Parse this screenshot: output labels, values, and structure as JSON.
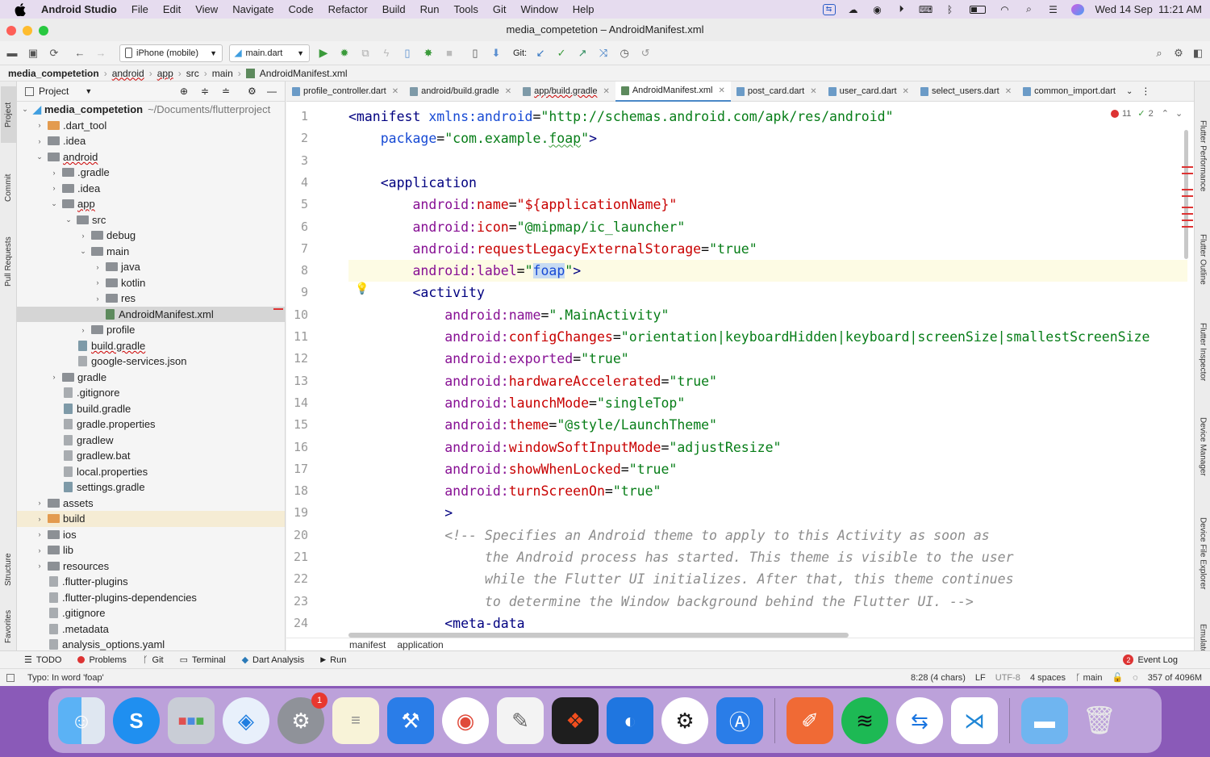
{
  "menubar": {
    "app": "Android Studio",
    "items": [
      "File",
      "Edit",
      "View",
      "Navigate",
      "Code",
      "Refactor",
      "Build",
      "Run",
      "Tools",
      "Git",
      "Window",
      "Help"
    ],
    "clock": "Wed 14 Sep  11:21 AM"
  },
  "window": {
    "title": "media_competetion – AndroidManifest.xml"
  },
  "toolbar": {
    "device": "iPhone (mobile)",
    "run_config": "main.dart",
    "git_label": "Git:"
  },
  "breadcrumb": [
    "media_competetion",
    "android",
    "app",
    "src",
    "main",
    "AndroidManifest.xml"
  ],
  "left_strip": {
    "project": "Project",
    "commit": "Commit",
    "pull_requests": "Pull Requests",
    "structure": "Structure",
    "favorites": "Favorites"
  },
  "right_strip": {
    "flutter_performance": "Flutter Performance",
    "flutter_outline": "Flutter Outline",
    "flutter_inspector": "Flutter Inspector",
    "device_manager": "Device Manager",
    "device_file_explorer": "Device File Explorer",
    "emulator": "Emulator"
  },
  "project_panel": {
    "title": "Project",
    "root": "media_competetion",
    "root_path": "~/Documents/flutterproject",
    "items": [
      {
        "label": ".dart_tool"
      },
      {
        "label": ".idea"
      },
      {
        "label": "android"
      },
      {
        "label": ".gradle"
      },
      {
        "label": ".idea"
      },
      {
        "label": "app"
      },
      {
        "label": "src"
      },
      {
        "label": "debug"
      },
      {
        "label": "main"
      },
      {
        "label": "java"
      },
      {
        "label": "kotlin"
      },
      {
        "label": "res"
      },
      {
        "label": "AndroidManifest.xml"
      },
      {
        "label": "profile"
      },
      {
        "label": "build.gradle"
      },
      {
        "label": "google-services.json"
      },
      {
        "label": "gradle"
      },
      {
        "label": ".gitignore"
      },
      {
        "label": "build.gradle"
      },
      {
        "label": "gradle.properties"
      },
      {
        "label": "gradlew"
      },
      {
        "label": "gradlew.bat"
      },
      {
        "label": "local.properties"
      },
      {
        "label": "settings.gradle"
      },
      {
        "label": "assets"
      },
      {
        "label": "build"
      },
      {
        "label": "ios"
      },
      {
        "label": "lib"
      },
      {
        "label": "resources"
      },
      {
        "label": ".flutter-plugins"
      },
      {
        "label": ".flutter-plugins-dependencies"
      },
      {
        "label": ".gitignore"
      },
      {
        "label": ".metadata"
      },
      {
        "label": "analysis_options.yaml"
      }
    ]
  },
  "tabs": [
    "profile_controller.dart",
    "android/build.gradle",
    "app/build.gradle",
    "AndroidManifest.xml",
    "post_card.dart",
    "user_card.dart",
    "select_users.dart",
    "common_import.dart"
  ],
  "inspections": {
    "errors": "11",
    "warnings": "2"
  },
  "code_lines": [
    {
      "n": "1",
      "parts": [
        [
          "t-tag",
          "<manifest "
        ],
        [
          "t-attr",
          "xmlns:android"
        ],
        [
          "",
          "="
        ],
        [
          "t-val",
          "\"http://schemas.android.com/apk/res/android\""
        ]
      ]
    },
    {
      "n": "2",
      "parts": [
        [
          "",
          "    "
        ],
        [
          "t-attr",
          "package"
        ],
        [
          "",
          "="
        ],
        [
          "t-val",
          "\"com.example."
        ],
        [
          "t-val",
          "foap"
        ],
        [
          "t-val",
          "\""
        ],
        [
          "t-tag",
          ">"
        ]
      ]
    },
    {
      "n": "3",
      "parts": []
    },
    {
      "n": "4",
      "parts": [
        [
          "",
          "    "
        ],
        [
          "t-tag",
          "<application"
        ]
      ]
    },
    {
      "n": "5",
      "parts": [
        [
          "",
          "        "
        ],
        [
          "t-ns",
          "android:"
        ],
        [
          "t-red",
          "name"
        ],
        [
          "",
          "="
        ],
        [
          "t-red",
          "\"${applicationName}\""
        ]
      ]
    },
    {
      "n": "6",
      "parts": [
        [
          "",
          "        "
        ],
        [
          "t-ns",
          "android:"
        ],
        [
          "t-red",
          "icon"
        ],
        [
          "",
          "="
        ],
        [
          "t-val",
          "\"@mipmap/ic_launcher\""
        ]
      ]
    },
    {
      "n": "7",
      "parts": [
        [
          "",
          "        "
        ],
        [
          "t-ns",
          "android:"
        ],
        [
          "t-red",
          "requestLegacyExternalStorage"
        ],
        [
          "",
          "="
        ],
        [
          "t-val",
          "\"true\""
        ]
      ]
    },
    {
      "n": "8",
      "parts": [
        [
          "",
          "        "
        ],
        [
          "t-ns",
          "android:"
        ],
        [
          "t-aa",
          "label"
        ],
        [
          "",
          "="
        ],
        [
          "t-val",
          "\""
        ],
        [
          "t-attr",
          "foap"
        ],
        [
          "t-val",
          "\""
        ],
        [
          "t-tag",
          ">"
        ]
      ]
    },
    {
      "n": "9",
      "parts": [
        [
          "",
          "        "
        ],
        [
          "t-tag",
          "<activity"
        ]
      ]
    },
    {
      "n": "10",
      "parts": [
        [
          "",
          "            "
        ],
        [
          "t-ns",
          "android:"
        ],
        [
          "t-aa",
          "name"
        ],
        [
          "",
          "="
        ],
        [
          "t-val",
          "\".MainActivity\""
        ]
      ]
    },
    {
      "n": "11",
      "parts": [
        [
          "",
          "            "
        ],
        [
          "t-ns",
          "android:"
        ],
        [
          "t-red",
          "configChanges"
        ],
        [
          "",
          "="
        ],
        [
          "t-val",
          "\"orientation|keyboardHidden|keyboard|screenSize|smallestScreenSize"
        ]
      ]
    },
    {
      "n": "12",
      "parts": [
        [
          "",
          "            "
        ],
        [
          "t-ns",
          "android:"
        ],
        [
          "t-aa",
          "exported"
        ],
        [
          "",
          "="
        ],
        [
          "t-val",
          "\"true\""
        ]
      ]
    },
    {
      "n": "13",
      "parts": [
        [
          "",
          "            "
        ],
        [
          "t-ns",
          "android:"
        ],
        [
          "t-red",
          "hardwareAccelerated"
        ],
        [
          "",
          "="
        ],
        [
          "t-val",
          "\"true\""
        ]
      ]
    },
    {
      "n": "14",
      "parts": [
        [
          "",
          "            "
        ],
        [
          "t-ns",
          "android:"
        ],
        [
          "t-red",
          "launchMode"
        ],
        [
          "",
          "="
        ],
        [
          "t-val",
          "\"singleTop\""
        ]
      ]
    },
    {
      "n": "15",
      "parts": [
        [
          "",
          "            "
        ],
        [
          "t-ns",
          "android:"
        ],
        [
          "t-red",
          "theme"
        ],
        [
          "",
          "="
        ],
        [
          "t-val",
          "\"@style/LaunchTheme\""
        ]
      ]
    },
    {
      "n": "16",
      "parts": [
        [
          "",
          "            "
        ],
        [
          "t-ns",
          "android:"
        ],
        [
          "t-red",
          "windowSoftInputMode"
        ],
        [
          "",
          "="
        ],
        [
          "t-val",
          "\"adjustResize\""
        ]
      ]
    },
    {
      "n": "17",
      "parts": [
        [
          "",
          "            "
        ],
        [
          "t-ns",
          "android:"
        ],
        [
          "t-red",
          "showWhenLocked"
        ],
        [
          "",
          "="
        ],
        [
          "t-val",
          "\"true\""
        ]
      ]
    },
    {
      "n": "18",
      "parts": [
        [
          "",
          "            "
        ],
        [
          "t-ns",
          "android:"
        ],
        [
          "t-red",
          "turnScreenOn"
        ],
        [
          "",
          "="
        ],
        [
          "t-val",
          "\"true\""
        ]
      ]
    },
    {
      "n": "19",
      "parts": [
        [
          "",
          "            "
        ],
        [
          "t-tag",
          ">"
        ]
      ]
    },
    {
      "n": "20",
      "parts": [
        [
          "",
          "            "
        ],
        [
          "t-com",
          "<!-- Specifies an Android theme to apply to this Activity as soon as"
        ]
      ]
    },
    {
      "n": "21",
      "parts": [
        [
          "",
          "                 "
        ],
        [
          "t-com",
          "the Android process has started. This theme is visible to the user"
        ]
      ]
    },
    {
      "n": "22",
      "parts": [
        [
          "",
          "                 "
        ],
        [
          "t-com",
          "while the Flutter UI initializes. After that, this theme continues"
        ]
      ]
    },
    {
      "n": "23",
      "parts": [
        [
          "",
          "                 "
        ],
        [
          "t-com",
          "to determine the Window background behind the Flutter UI. -->"
        ]
      ]
    },
    {
      "n": "24",
      "parts": [
        [
          "",
          "            "
        ],
        [
          "t-tag",
          "<meta-data"
        ]
      ]
    }
  ],
  "editor_breadcrumb": [
    "manifest",
    "application"
  ],
  "bottom_tools": [
    "TODO",
    "Problems",
    "Git",
    "Terminal",
    "Dart Analysis",
    "Run"
  ],
  "event_log": {
    "count": "2",
    "label": "Event Log"
  },
  "status": {
    "message": "Typo: In word 'foap'",
    "position": "8:28 (4 chars)",
    "line_sep": "LF",
    "encoding": "UTF-8",
    "indent": "4 spaces",
    "branch": "main",
    "memory": "357 of 4096M"
  },
  "dock": {
    "settings_badge": "1"
  },
  "colors": {
    "accent": "#4a88c7",
    "error": "#e8382f"
  }
}
